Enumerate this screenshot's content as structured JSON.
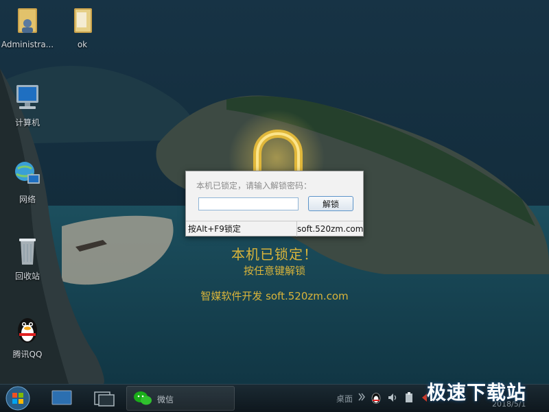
{
  "desktop": {
    "icons": [
      {
        "label": "Administra..."
      },
      {
        "label": "ok"
      },
      {
        "label": "计算机"
      },
      {
        "label": "网络"
      },
      {
        "label": "回收站"
      },
      {
        "label": "腾讯QQ"
      }
    ]
  },
  "lock_screen": {
    "title": "本机已锁定！",
    "subtitle": "按任意键解锁",
    "developer": "智媒软件开发  soft.520zm.com"
  },
  "dialog": {
    "prompt": "本机已锁定，请输入解锁密码：",
    "password_value": "",
    "unlock_button": "解锁",
    "status_left": "按Alt+F9锁定",
    "status_right": "soft.520zm.com"
  },
  "taskbar": {
    "wechat_label": "微信",
    "desktop_label": "桌面",
    "clock_date": "2018/5/1"
  },
  "watermark": "极速下载站",
  "colors": {
    "lock_text": "#d9b43a",
    "taskbar": "#13212a",
    "wechat_green": "#1aad19"
  }
}
